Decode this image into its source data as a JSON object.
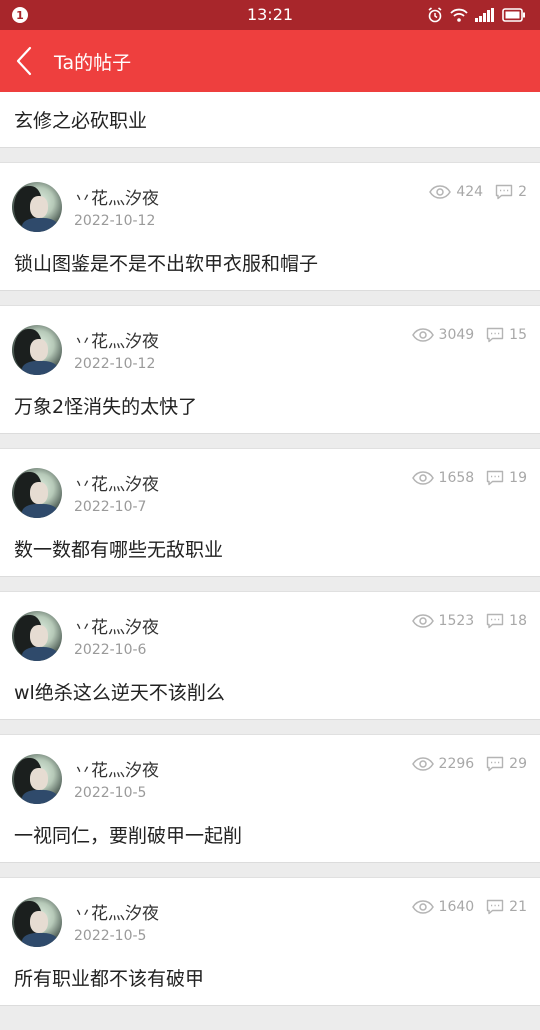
{
  "status_bar": {
    "notification_count": "1",
    "time": "13:21"
  },
  "header": {
    "title": "Ta的帖子"
  },
  "first_post": {
    "title": "玄修之必砍职业"
  },
  "posts": [
    {
      "user": "丷花灬汐夜",
      "date": "2022-10-12",
      "views": "424",
      "comments": "2",
      "title": "锁山图鉴是不是不出软甲衣服和帽子"
    },
    {
      "user": "丷花灬汐夜",
      "date": "2022-10-12",
      "views": "3049",
      "comments": "15",
      "title": "万象2怪消失的太快了"
    },
    {
      "user": "丷花灬汐夜",
      "date": "2022-10-7",
      "views": "1658",
      "comments": "19",
      "title": "数一数都有哪些无敌职业"
    },
    {
      "user": "丷花灬汐夜",
      "date": "2022-10-6",
      "views": "1523",
      "comments": "18",
      "title": "wl绝杀这么逆天不该削么"
    },
    {
      "user": "丷花灬汐夜",
      "date": "2022-10-5",
      "views": "2296",
      "comments": "29",
      "title": "一视同仁，要削破甲一起削"
    },
    {
      "user": "丷花灬汐夜",
      "date": "2022-10-5",
      "views": "1640",
      "comments": "21",
      "title": "所有职业都不该有破甲"
    }
  ],
  "colors": {
    "status_bar": "#a8262b",
    "title_bar": "#ee3f3e",
    "meta_text": "#a8a8a8"
  }
}
